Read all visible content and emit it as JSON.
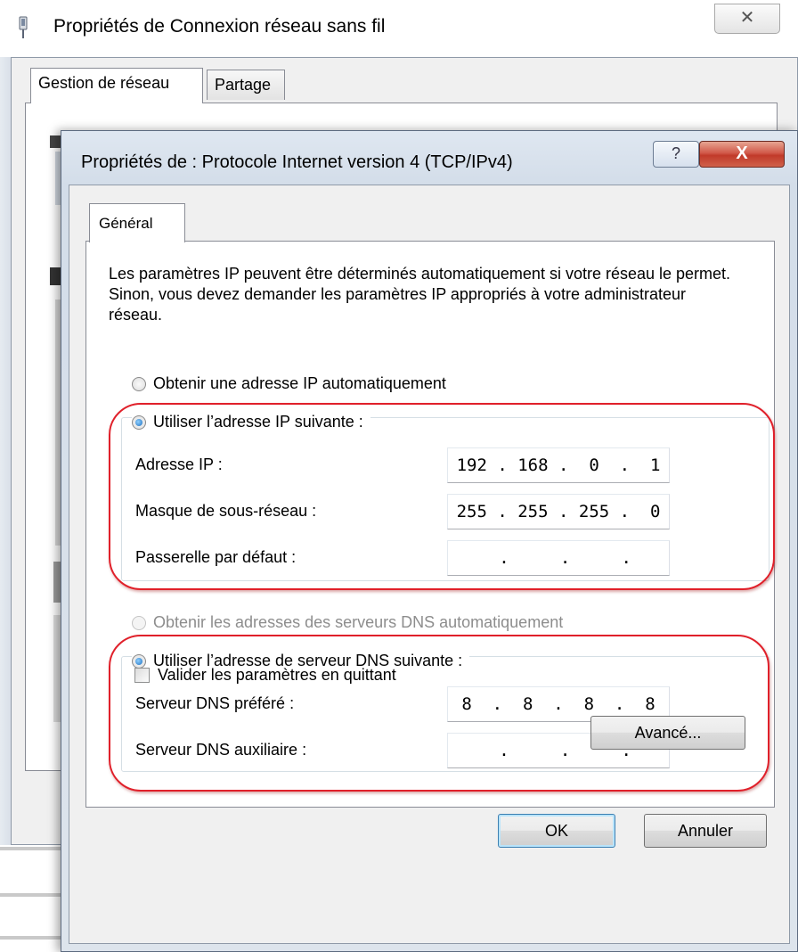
{
  "outer_window": {
    "title": "Propriétés de Connexion réseau sans fil",
    "close_glyph": "✕",
    "tabs": [
      {
        "label": "Gestion de réseau",
        "active": true
      },
      {
        "label": "Partage",
        "active": false
      }
    ]
  },
  "dialog": {
    "title": "Propriétés de : Protocole Internet version 4 (TCP/IPv4)",
    "help_glyph": "?",
    "close_glyph": "X",
    "tab": "Général",
    "intro": "Les paramètres IP peuvent être déterminés automatiquement si votre réseau le permet. Sinon, vous devez demander les paramètres IP appropriés à votre administrateur réseau.",
    "ip_auto": {
      "label": "Obtenir une adresse IP automatiquement",
      "selected": false
    },
    "ip_manual": {
      "label": "Utiliser l’adresse IP suivante :",
      "selected": true
    },
    "ip_fields": [
      {
        "label": "Adresse IP :",
        "value": "192 . 168 .  0  .  1"
      },
      {
        "label": "Masque de sous-réseau :",
        "value": "255 . 255 . 255 .  0"
      },
      {
        "label": "Passerelle par défaut :",
        "value": "     .     .     .    "
      }
    ],
    "dns_auto": {
      "label": "Obtenir les adresses des serveurs DNS automatiquement",
      "selected": false,
      "disabled": true
    },
    "dns_manual": {
      "label": "Utiliser l’adresse de serveur DNS suivante :",
      "selected": true
    },
    "dns_fields": [
      {
        "label": "Serveur DNS préféré :",
        "value": " 8  .  8  .  8  .  8 "
      },
      {
        "label": "Serveur DNS auxiliaire :",
        "value": "     .     .     .    "
      }
    ],
    "validate_checkbox": {
      "label": "Valider les paramètres en quittant",
      "checked": false
    },
    "buttons": {
      "advanced": "Avancé...",
      "ok": "OK",
      "cancel": "Annuler"
    },
    "highlight_color": "#e0202a"
  }
}
